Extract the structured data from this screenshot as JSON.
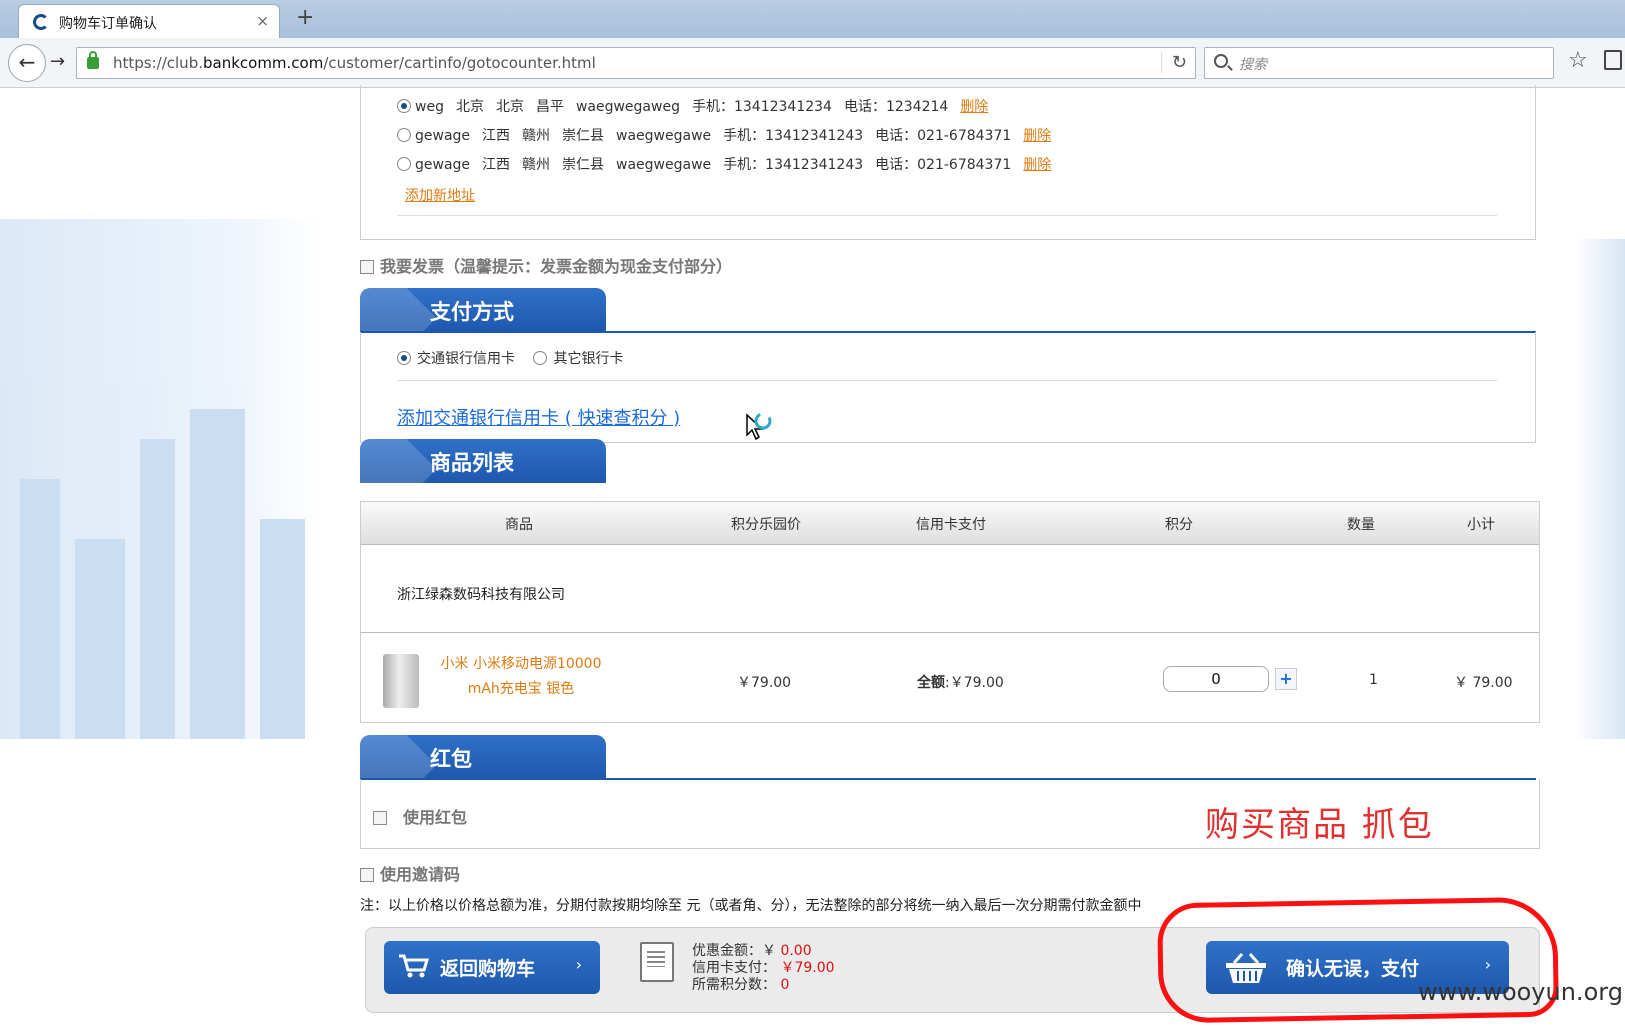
{
  "browser": {
    "tab_title": "购物车订单确认",
    "tab_close": "×",
    "new_tab": "+",
    "url_prefix": "https://club.",
    "url_domain": "bankcomm.com",
    "url_path": "/customer/cartinfo/gotocounter.html",
    "search_placeholder": "搜索"
  },
  "addresses": [
    {
      "name": "weg",
      "province": "北京",
      "city": "北京",
      "district": "昌平",
      "street": "waegwegaweg",
      "mobile": "手机：13412341234",
      "phone": "电话：1234214",
      "delete": "删除",
      "selected": true
    },
    {
      "name": "gewage",
      "province": "江西",
      "city": "赣州",
      "district": "崇仁县",
      "street": "waegwegawe",
      "mobile": "手机：13412341243",
      "phone": "电话：021-6784371",
      "delete": "删除",
      "selected": false
    },
    {
      "name": "gewage",
      "province": "江西",
      "city": "赣州",
      "district": "崇仁县",
      "street": "waegwegawe",
      "mobile": "手机：13412341243",
      "phone": "电话：021-6784371",
      "delete": "删除",
      "selected": false
    }
  ],
  "add_address": "添加新地址",
  "invoice_label": "我要发票（温馨提示：发票金额为现金支付部分）",
  "payment": {
    "title": "支付方式",
    "option1": "交通银行信用卡",
    "option2": "其它银行卡",
    "add_card_link": "添加交通银行信用卡 ( 快速查积分 )"
  },
  "goods": {
    "title": "商品列表",
    "headers": [
      "商品",
      "积分乐园价",
      "信用卡支付",
      "积分",
      "数量",
      "小计"
    ],
    "shop": "浙江绿森数码科技有限公司",
    "item": {
      "name": "小米 小米移动电源10000 mAh充电宝 银色",
      "price": "￥79.00",
      "credit_label": "全额",
      "credit_value": ":￥79.00",
      "points": "0",
      "plus": "+",
      "quantity": "1",
      "subtotal": "￥ 79.00"
    }
  },
  "redpacket": {
    "title": "红包",
    "use_label": "使用红包"
  },
  "annotation": "购买商品  抓包",
  "invite_label": "使用邀请码",
  "note": "注：以上价格以价格总额为准，分期付款按期均除至 元（或者角、分），无法整除的部分将统一纳入最后一次分期需付款金额中",
  "summary": {
    "discount_label": "优惠金额：￥",
    "discount_value": "0.00",
    "credit_label": "信用卡支付：",
    "credit_value": "￥79.00",
    "points_label": "所需积分数：",
    "points_value": "0"
  },
  "buttons": {
    "back": "返回购物车",
    "pay": "确认无误，支付",
    "arrow": "›"
  },
  "watermark": "www.wooyun.org",
  "colors": {
    "brand_blue": "#1e58ad",
    "link_orange": "#e07a10",
    "price_red": "#e01010",
    "annotation_red": "#ff1010"
  }
}
